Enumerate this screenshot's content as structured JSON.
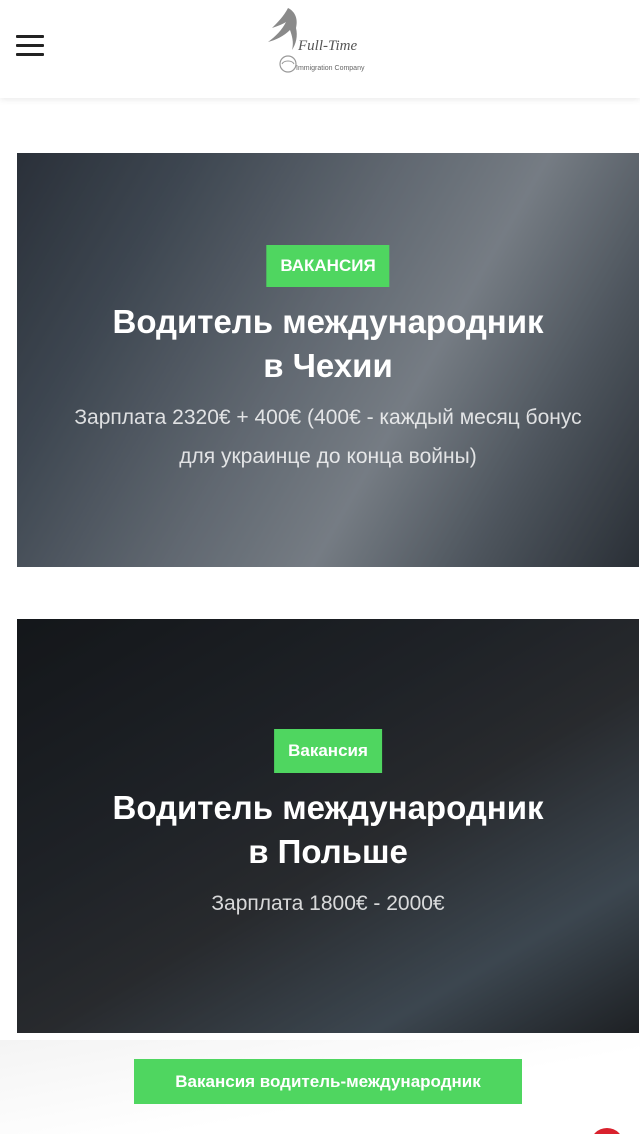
{
  "header": {
    "menu_icon": "hamburger-menu-icon",
    "logo": {
      "name": "Full-Time",
      "subtitle": "Immigration Company",
      "icon": "bird-logo-icon"
    }
  },
  "vacancies": [
    {
      "badge": "ВАКАНСИЯ",
      "title_line1": "Водитель международник",
      "title_line2": "в Чехии",
      "salary": "Зарплата 2320€ + 400€ (400€ - каждый месяц бонус для украинце до конца войны)"
    },
    {
      "badge": "Вакансия",
      "title_line1": "Водитель международник",
      "title_line2": "в Польше",
      "salary": "Зарплата 1800€ - 2000€"
    }
  ],
  "cta": {
    "label": "Вакансия водитель-международник"
  },
  "colors": {
    "accent": "#4fd660",
    "text_on_dark": "#ffffff",
    "header_bg": "#ffffff"
  }
}
